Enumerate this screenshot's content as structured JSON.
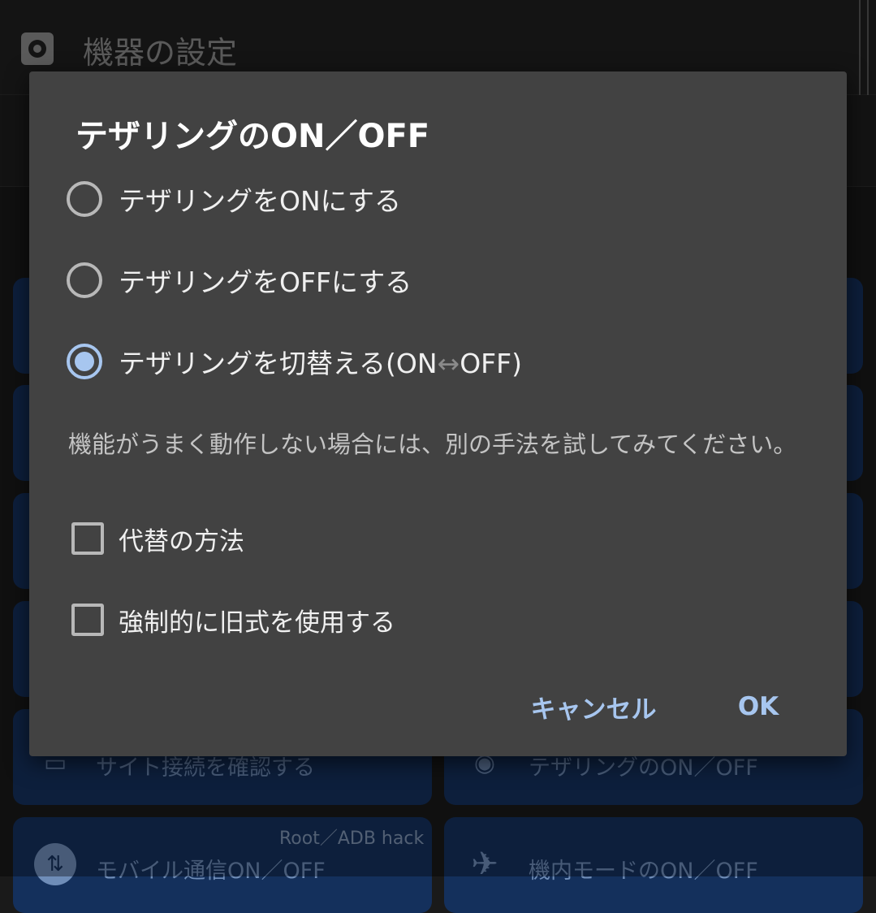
{
  "background": {
    "header_title": "機器の設定",
    "tiles": [
      {
        "label": "サイト接続を確認する",
        "icon": "monitor-icon"
      },
      {
        "label": "テザリングのON／OFF",
        "icon": "tethering-icon"
      },
      {
        "label": "モバイル通信ON／OFF",
        "sub": "Root／ADB hack",
        "icon": "mobile-data-icon"
      },
      {
        "label": "機内モードのON／OFF",
        "icon": "airplane-icon"
      }
    ],
    "colors": {
      "tile": "#14305c",
      "screen": "#1a1a1a"
    }
  },
  "dialog": {
    "title": "テザリングのON／OFF",
    "options": [
      {
        "label": "テザリングをONにする",
        "selected": false
      },
      {
        "label": "テザリングをOFFにする",
        "selected": false
      },
      {
        "label_before": "テザリングを切替える(ON",
        "label_arrow": "↔",
        "label_after": "OFF)",
        "selected": true
      }
    ],
    "hint": "機能がうまく動作しない場合には、別の手法を試してみてください。",
    "checkboxes": [
      {
        "label": "代替の方法",
        "checked": false
      },
      {
        "label": "強制的に旧式を使用する",
        "checked": false
      }
    ],
    "cancel_label": "キャンセル",
    "ok_label": "OK",
    "colors": {
      "accent": "#a7c6ef",
      "surface": "#424242"
    }
  }
}
